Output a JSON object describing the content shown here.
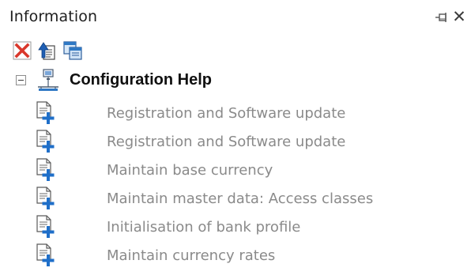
{
  "panel": {
    "title": "Information",
    "pin_icon": "pin-icon",
    "close_icon": "close-icon",
    "close_glyph": "✕"
  },
  "toolbar": {
    "buttons": [
      {
        "icon": "delete-icon",
        "color": "#d9372b"
      },
      {
        "icon": "export-document-icon",
        "color": "#1f5fb4"
      },
      {
        "icon": "copy-windows-icon",
        "color": "#2f78c4"
      }
    ]
  },
  "tree": {
    "root": {
      "label": "Configuration Help",
      "icon": "network-computer-icon",
      "expanded": true
    },
    "items": [
      {
        "label": "Registration and Software update",
        "icon": "document-add-icon"
      },
      {
        "label": "Registration and Software update",
        "icon": "document-add-icon"
      },
      {
        "label": "Maintain base currency",
        "icon": "document-add-icon"
      },
      {
        "label": "Maintain master data: Access classes",
        "icon": "document-add-icon"
      },
      {
        "label": "Initialisation of bank profile",
        "icon": "document-add-icon"
      },
      {
        "label": "Maintain currency rates",
        "icon": "document-add-icon"
      }
    ]
  },
  "colors": {
    "item_text": "#8a8a8a",
    "root_text": "#101010",
    "icon_blue": "#1f6fc9"
  }
}
